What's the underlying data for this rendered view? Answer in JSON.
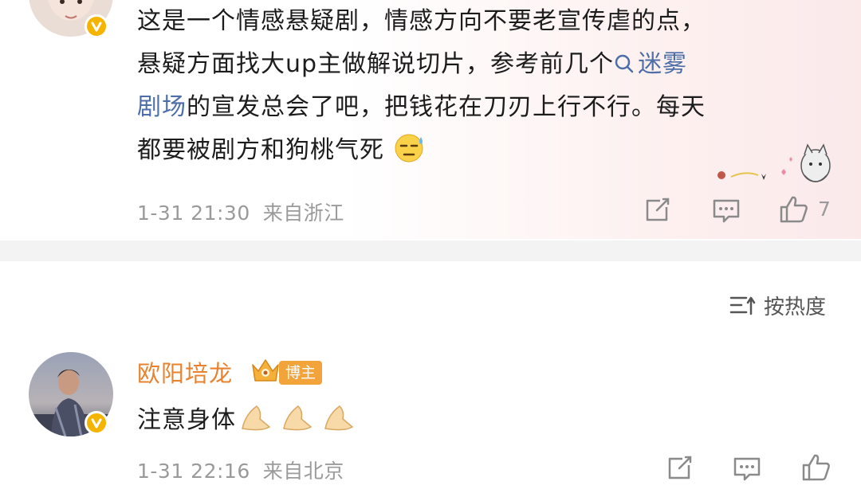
{
  "post": {
    "text_line1": "这是一个情感悬疑剧，情感方向不要老宣传虐的点，",
    "text_line2_pre": "悬疑方面找大up主做解说切片，参考前几个",
    "link_part1": "迷雾",
    "link_part2": "剧场",
    "text_line3_post": "的宣发总会了吧，把钱花在刀刃上行不行。每天",
    "text_line4": "都要被剧方和狗桃气死",
    "emoji": "sweat-face-emoji",
    "timestamp": "1-31 21:30",
    "location": "来自浙江",
    "like_count": "7"
  },
  "sort": {
    "label": "按热度",
    "icon": "sort-icon"
  },
  "comment": {
    "username": "欧阳培龙",
    "badge": "博主",
    "text": "注意身体",
    "emoji": "pray-hands-emoji",
    "timestamp": "1-31 22:16",
    "location": "来自北京"
  },
  "colors": {
    "username": "#e8822e",
    "link": "#4d6ea8",
    "meta": "#9a9a9a",
    "verified": "#f5b400",
    "badge": "#f2a33a"
  }
}
